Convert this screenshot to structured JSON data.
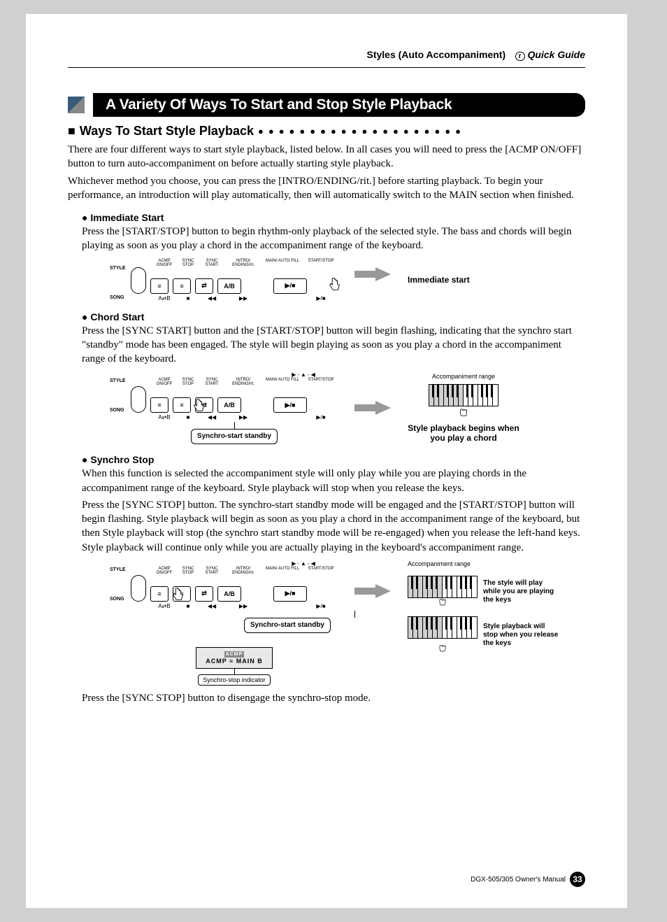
{
  "header": {
    "section": "Styles (Auto Accompaniment)",
    "pill": "r",
    "guide": "Quick Guide"
  },
  "title": "A Variety Of Ways To Start and Stop Style Playback",
  "subhead1": "Ways To Start Style Playback",
  "intro_p1": "There are four different ways to start style playback, listed below. In all cases you will need to press the [ACMP ON/OFF] button to turn auto-accompaniment on before actually starting style playback.",
  "intro_p2": "Whichever method you choose, you can press the [INTRO/ENDING/rit.] before starting playback. To begin your performance, an introduction will play automatically, then will automatically switch to the MAIN section when finished.",
  "panel_labels": {
    "top": [
      "ACMP ON/OFF",
      "SYNC STOP",
      "SYNC START",
      "INTRO/ ENDING/rit.",
      "MAIN/ AUTO FILL",
      "START/STOP"
    ],
    "ab": "A/B",
    "play_stop": "▶/■",
    "bot": [
      "A⇄B",
      "■",
      "◀◀",
      "▶▶",
      "▶/■"
    ],
    "style": "STYLE",
    "song": "SONG"
  },
  "immediate": {
    "head": "Immediate Start",
    "body": "Press the [START/STOP] button to begin rhythm-only playback of the selected style. The bass and chords will begin playing as soon as you play a chord in the accompaniment range of the keyboard.",
    "caption": "Immediate start"
  },
  "chord": {
    "head": "Chord Start",
    "body": "Press the [SYNC START] button and the [START/STOP] button will begin flashing, indicating that the synchro start \"standby\" mode has been engaged. The style will begin playing as soon as you play a chord in the accompaniment range of the keyboard.",
    "callout": "Synchro-start standby",
    "accomp_label": "Accompaniment range",
    "caption": "Style playback begins when you play a chord"
  },
  "synchro": {
    "head": "Synchro Stop",
    "body1": "When this function is selected the accompaniment style will only play while you are playing chords in the accompaniment range of the keyboard. Style playback will stop when you release the keys.",
    "body2": "Press the [SYNC STOP] button. The synchro-start standby mode will be engaged and the [START/STOP] button will begin flashing. Style playback will begin as soon as you play a chord in the accompaniment range of the keyboard, but then Style playback will stop (the synchro start standby mode will be re-engaged) when you release the left-hand keys. Style playback will continue only while you are actually playing in the keyboard's accompaniment range.",
    "callout": "Synchro-start standby",
    "accomp_label": "Accompaniment range",
    "note1": "The style will play while you are playing the keys",
    "note2": "Style playback will stop when you release the keys",
    "lcd_top": "ACMP",
    "lcd_main": "ACMP ≡ MAIN B",
    "indicator_label": "Synchro-stop indicator",
    "closing": "Press the [SYNC STOP] button to disengage the synchro-stop mode."
  },
  "footer": {
    "model": "DGX-505/305  Owner's Manual",
    "page": "33"
  }
}
